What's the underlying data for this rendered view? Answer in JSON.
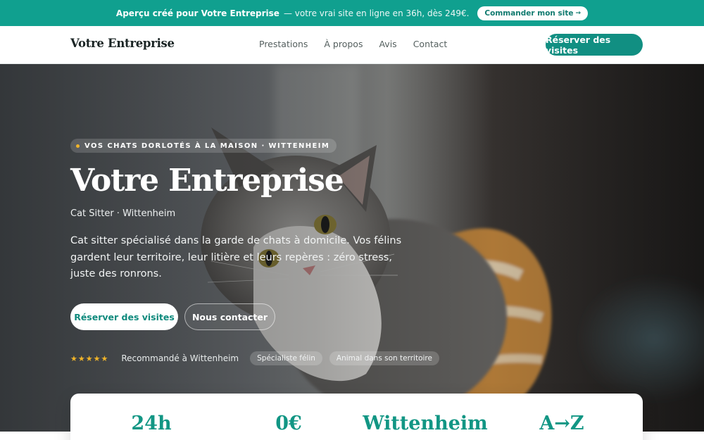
{
  "promo": {
    "bold_text": "Aperçu créé pour Votre Entreprise",
    "text": "— votre vrai site en ligne en 36h, dès 249€.",
    "button_label": "Commander mon site",
    "button_arrow": "→"
  },
  "nav": {
    "brand": "Votre Entreprise",
    "links": [
      "Prestations",
      "À propos",
      "Avis",
      "Contact"
    ],
    "cta": "Réserver des visites"
  },
  "hero": {
    "eyebrow": "VOS CHATS DORLOTÉS À LA MAISON · WITTENHEIM",
    "title": "Votre Entreprise",
    "subtitle": "Cat Sitter · Wittenheim",
    "description": "Cat sitter spécialisé dans la garde de chats à domicile. Vos félins gardent leur territoire, leur litière et leurs repères : zéro stress, juste des ronrons.",
    "primary_button": "Réserver des visites",
    "secondary_button": "Nous contacter",
    "stars": "★★★★★",
    "rating_count": 5,
    "trust_text": "Recommandé à Wittenheim",
    "chips": [
      "Spécialiste félin",
      "Animal dans son territoire"
    ],
    "image_description": "grey-and-white-cat-photo"
  },
  "stats": {
    "values": [
      "24h",
      "0€",
      "Wittenheim",
      "A→Z"
    ]
  },
  "colors": {
    "accent": "#118f82",
    "promo_bg": "#10a08f",
    "stat_text": "#129684",
    "star": "#f0b429"
  }
}
